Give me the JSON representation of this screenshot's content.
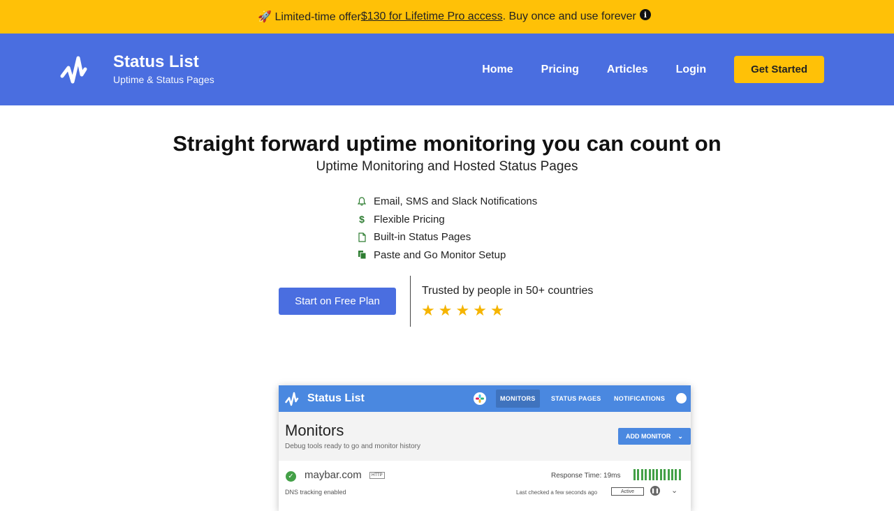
{
  "promo": {
    "prefix": "🚀 Limited-time offer ",
    "link": "$130 for Lifetime Pro access",
    "suffix": ". Buy once and use forever",
    "info_glyph": "i"
  },
  "brand": {
    "title": "Status List",
    "subtitle": "Uptime & Status Pages"
  },
  "nav": {
    "links": [
      "Home",
      "Pricing",
      "Articles",
      "Login"
    ],
    "cta": "Get Started"
  },
  "hero": {
    "title": "Straight forward uptime monitoring you can count on",
    "subtitle": "Uptime Monitoring and Hosted Status Pages",
    "features": [
      {
        "icon": "bell-icon",
        "label": "Email, SMS and Slack Notifications"
      },
      {
        "icon": "dollar-icon",
        "label": "Flexible Pricing"
      },
      {
        "icon": "file-icon",
        "label": "Built-in Status Pages"
      },
      {
        "icon": "copy-icon",
        "label": "Paste and Go Monitor Setup"
      }
    ],
    "cta": "Start on Free Plan",
    "trusted": "Trusted by people in 50+ countries",
    "rating_stars": 5
  },
  "mockup": {
    "title": "Status List",
    "tabs": [
      "MONITORS",
      "STATUS PAGES",
      "NOTIFICATIONS"
    ],
    "heading": "Monitors",
    "subheading": "Debug tools ready to go and monitor history",
    "add_button": "ADD MONITOR",
    "monitor": {
      "domain": "maybar.com",
      "tag": "HTTP",
      "note": "DNS tracking enabled",
      "response": "Response Time: 19ms",
      "last_checked": "Last checked a few seconds ago",
      "status": "Active"
    }
  },
  "colors": {
    "promo": "#ffc107",
    "nav": "#4a6ee0",
    "accent_green": "#43a047",
    "star": "#f5b400"
  }
}
